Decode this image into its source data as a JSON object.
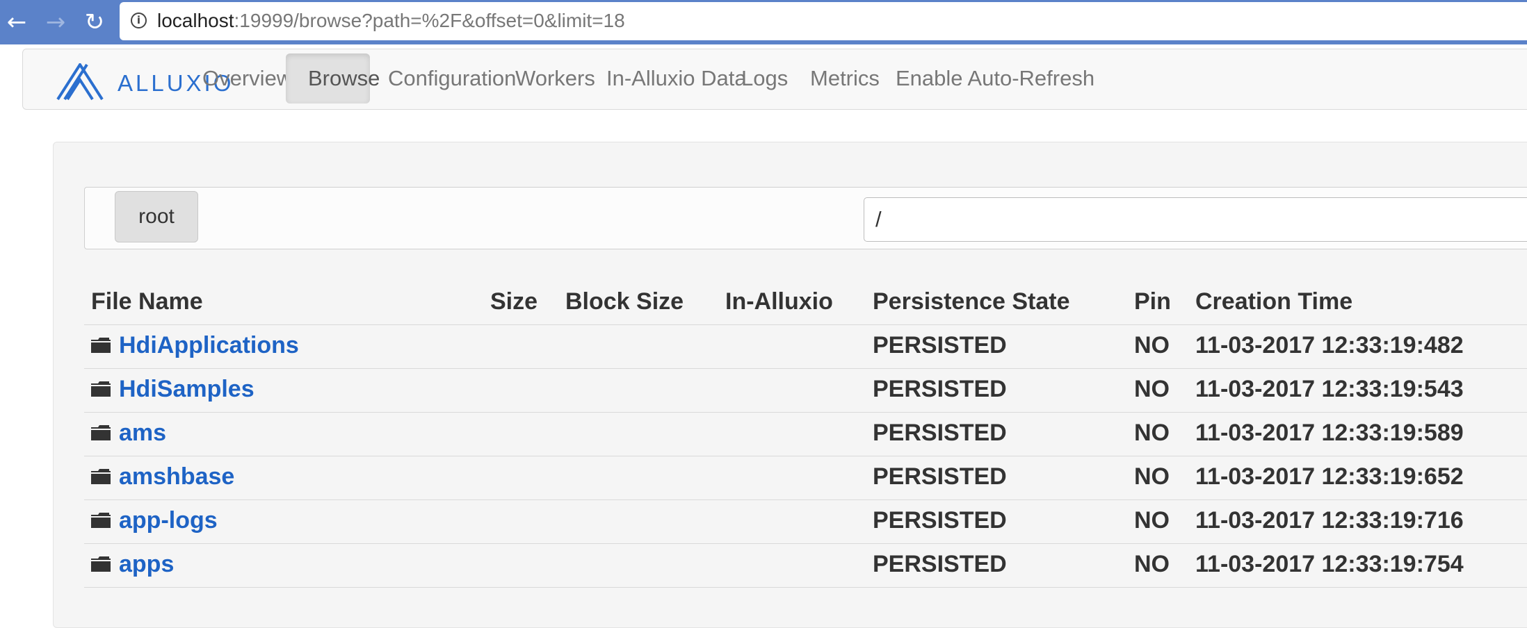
{
  "browser": {
    "url_host": "localhost",
    "url_rest": ":19999/browse?path=%2F&offset=0&limit=18",
    "back_icon": "back-arrow-icon",
    "forward_icon": "forward-arrow-icon",
    "reload_icon": "reload-icon"
  },
  "navbar": {
    "logo_text": "ALLUXIO",
    "brand_color": "#2b6fcf",
    "items": [
      {
        "label": "Overview"
      },
      {
        "label": "Browse"
      },
      {
        "label": "Configuration"
      },
      {
        "label": "Workers"
      },
      {
        "label": "In-Alluxio Data"
      },
      {
        "label": "Logs"
      },
      {
        "label": "Metrics"
      },
      {
        "label": "Enable Auto-Refresh"
      }
    ],
    "active": "Browse"
  },
  "path": {
    "root_label": "root",
    "input_value": "/"
  },
  "table": {
    "headers": [
      "File Name",
      "Size",
      "Block Size",
      "In-Alluxio",
      "Persistence State",
      "Pin",
      "Creation Time"
    ],
    "rows": [
      {
        "name": "HdiApplications",
        "persistence": "PERSISTED",
        "pin": "NO",
        "created": "11-03-2017 12:33:19:482"
      },
      {
        "name": "HdiSamples",
        "persistence": "PERSISTED",
        "pin": "NO",
        "created": "11-03-2017 12:33:19:543"
      },
      {
        "name": "ams",
        "persistence": "PERSISTED",
        "pin": "NO",
        "created": "11-03-2017 12:33:19:589"
      },
      {
        "name": "amshbase",
        "persistence": "PERSISTED",
        "pin": "NO",
        "created": "11-03-2017 12:33:19:652"
      },
      {
        "name": "app-logs",
        "persistence": "PERSISTED",
        "pin": "NO",
        "created": "11-03-2017 12:33:19:716"
      },
      {
        "name": "apps",
        "persistence": "PERSISTED",
        "pin": "NO",
        "created": "11-03-2017 12:33:19:754"
      }
    ],
    "row_icon": "folder-icon",
    "link_color": "#1e63c5"
  }
}
